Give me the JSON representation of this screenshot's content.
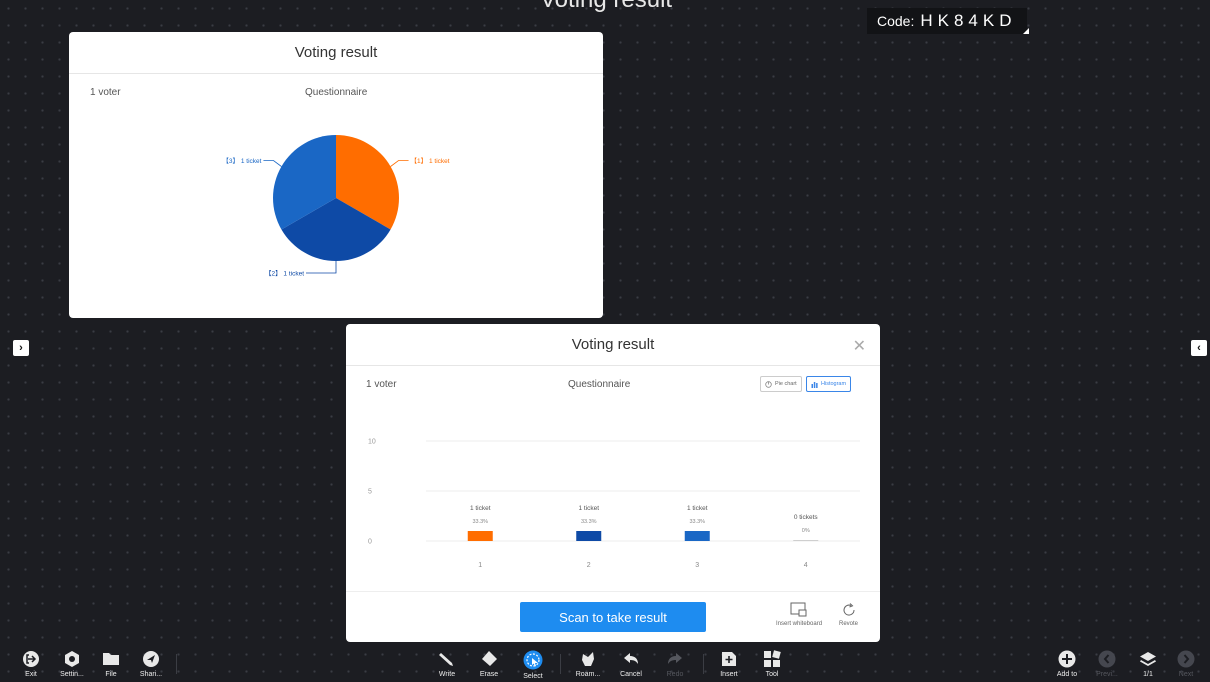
{
  "header": {
    "title": "Voting result",
    "code_label": "Code:",
    "code_value": "HK84KD"
  },
  "pie_panel": {
    "title": "Voting result",
    "voters": "1 voter",
    "question": "Questionnaire"
  },
  "bar_panel": {
    "title": "Voting result",
    "voters": "1 voter",
    "question": "Questionnaire",
    "view_pie": "Pie chart",
    "view_hist": "Histogram",
    "scan_button": "Scan to take result",
    "insert_whiteboard": "Insert whiteboard",
    "revote": "Revote"
  },
  "chart_data": [
    {
      "type": "pie",
      "categories": [
        "1",
        "2",
        "3"
      ],
      "values": [
        1,
        1,
        1
      ],
      "labels": [
        "【1】 1 ticket",
        "【2】 1 ticket",
        "【3】 1 ticket"
      ],
      "colors": [
        "#ff6d00",
        "#0e4aa6",
        "#1a67c5"
      ]
    },
    {
      "type": "bar",
      "categories": [
        "1",
        "2",
        "3",
        "4"
      ],
      "values": [
        1,
        1,
        1,
        0
      ],
      "ticket_labels": [
        "1 ticket",
        "1 ticket",
        "1 ticket",
        "0 tickets"
      ],
      "percent_labels": [
        "33.3%",
        "33.3%",
        "33.3%",
        "0%"
      ],
      "yticks": [
        "0",
        "5",
        "10"
      ],
      "ylim": [
        0,
        10
      ],
      "colors": [
        "#ff6d00",
        "#0e4aa6",
        "#1a67c5",
        "#cfcfcf"
      ]
    }
  ],
  "toolbar": {
    "exit": "Exit",
    "settings": "Settin...",
    "file": "File",
    "share": "Shari...",
    "write": "Write",
    "erase": "Erase",
    "select": "Select",
    "roam": "Roam...",
    "cancel": "Cancel",
    "redo": "Redo",
    "insert": "Insert",
    "tool": "Tool",
    "add_to": "Add to",
    "prev": "Previ...",
    "page": "1/1",
    "next": "Next"
  },
  "colors": {
    "accent": "#1e8cf0",
    "orange": "#ff6d00",
    "background": "#1c1d22"
  }
}
